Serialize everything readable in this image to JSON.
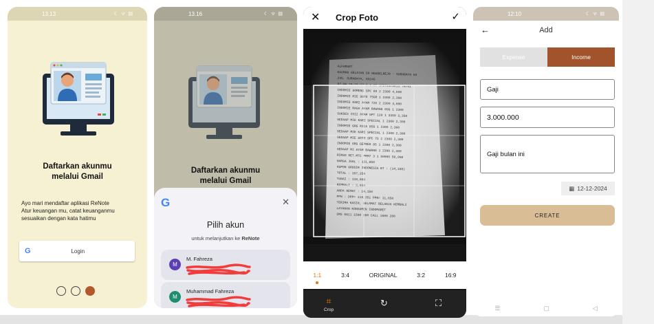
{
  "phone1": {
    "status_time": "13.13",
    "status_icons": "☾ ᯤ ▤",
    "title_line1": "Daftarkan akunmu",
    "title_line2": "melalui Gmail",
    "desc_line1": "Ayo mari mendaftar aplikasi ReNote",
    "desc_line2": "Atur keuangan mu, catat keuanganmu",
    "desc_line3": "sesuaikan dengan kata hatimu",
    "login_icon": "G",
    "login_label": "Login",
    "pagination_active_index": 3
  },
  "phone2": {
    "status_time": "13.16",
    "status_icons": "☾ ᯤ ▤",
    "title_line1": "Daftarkan akunmu",
    "title_line2": "melalui Gmail",
    "sheet": {
      "logo": "G",
      "close": "✕",
      "title": "Pilih akun",
      "subtitle_prefix": "untuk melanjutkan ke ",
      "subtitle_app": "ReNote",
      "accounts": [
        {
          "initial": "M",
          "name": "M. Fahreza",
          "avatar_color": "#5b3fb6"
        },
        {
          "initial": "M",
          "name": "Muhammad Fahreza",
          "avatar_color": "#1e8e6e"
        }
      ]
    }
  },
  "phone3": {
    "close": "✕",
    "title": "Crop Foto",
    "confirm": "✓",
    "ratios": [
      {
        "label": "1:1",
        "selected": true
      },
      {
        "label": "3:4",
        "selected": false
      },
      {
        "label": "ORIGINAL",
        "selected": false
      },
      {
        "label": "3:2",
        "selected": false
      },
      {
        "label": "16:9",
        "selected": false
      }
    ],
    "accent": "#e8730c",
    "bottom": {
      "crop_label": "Crop"
    },
    "receipt_lines": [
      "ALFAMART",
      "KAUMAN SELATAN 50 NGAGELREJO - SURABAYA 60",
      "245, SURABAYA, 60245",
      "07.06.16-21:27   2.1.27 972724/ARIS TR/01",
      "INDOMIE GORENG SPC 80   2  2300   4,600",
      "INDOMIE MIE SOTO 75GR   1  2300   2,300",
      "INDOMIE KARI AYAM 72G   2  2300   4,600",
      "INDOMIE RASA AYAM BAWANG 69G  1  2300",
      "SUKSES ISI2 AYAM 5PT 129  1  3350  3,350",
      "SEDAAP MIE KARI SPECIAL 1  2300  2,300",
      "INDOMIE GRG RICA 85G    1  2300   2,300",
      "SEDAAP MIE KARI SPECIAL 1  2300  2,300",
      "SEDAAP MIE SOTO SPC 75 1  2300   2,300",
      "INDOMIE GRG GEPREK 85   1  2300   2,300",
      "SEDAAP MI AYAM BAWANG 1  2300   2,300",
      "RINSO DET.MTC PRM7 3   1 50000 50,000",
      "HARGA JUAL :   121,850",
      "KUPON GROSIR INDONESIA BT :  (14,150)",
      "TOTAL :   107,350",
      "TUNAI :   110,000",
      "KEMBALI :    2,650",
      "ANDA HEMAT :  14,150",
      "PPN : DPP= 110,351 PPN= 11,650",
      "TERIMA KASIH, SELAMAT BELANJA KEMBALI",
      "LAYANAN KONSUMEN INDOMARET",
      "SMS 0811 1500 280 CALL 1500 280"
    ]
  },
  "phone4": {
    "status_time": "12:10",
    "status_icons": "☾ ᯤ ▤",
    "back": "←",
    "title": "Add",
    "tabs": {
      "expense": "Expense",
      "income": "Income"
    },
    "category": "Gaji",
    "amount": "3.000.000",
    "note": "Gaji bulan ini",
    "date": "12-12-2024",
    "create": "CREATE",
    "nav": [
      "☰",
      "▢",
      "◁"
    ],
    "accent": "#a3532c",
    "button_color": "#d9be95"
  }
}
